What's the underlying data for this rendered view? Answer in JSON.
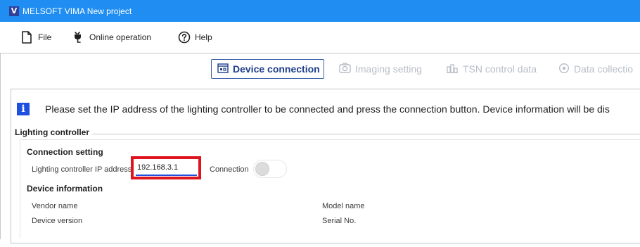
{
  "window": {
    "app_icon_glyph": "V",
    "title": "MELSOFT VIMA New project"
  },
  "menu": {
    "items": [
      {
        "label": "File",
        "icon": "file-icon"
      },
      {
        "label": "Online operation",
        "icon": "plug-icon"
      },
      {
        "label": "Help",
        "icon": "help-icon"
      }
    ]
  },
  "tabs": [
    {
      "label": "Device connection",
      "icon": "device-connection-icon",
      "state": "active"
    },
    {
      "label": "Imaging setting",
      "icon": "camera-icon",
      "state": "disabled"
    },
    {
      "label": "TSN control data",
      "icon": "tsn-control-icon",
      "state": "disabled"
    },
    {
      "label": "Data collectio",
      "icon": "record-icon",
      "state": "disabled"
    }
  ],
  "info": {
    "icon_glyph": "i",
    "message": "Please set the IP address of the lighting controller to be connected and press the connection button. Device information will be dis"
  },
  "lighting_controller": {
    "title": "Lighting controller",
    "connection_setting": {
      "heading": "Connection setting",
      "ip_label": "Lighting controller IP address",
      "ip_value": "192.168.3.1",
      "connection_label": "Connection",
      "connection_on": false
    },
    "device_information": {
      "heading": "Device information",
      "vendor_label": "Vendor name",
      "model_label": "Model name",
      "version_label": "Device version",
      "serial_label": "Serial No."
    }
  },
  "colors": {
    "titlebar": "#1f8df2",
    "accent": "#1e4fe0",
    "highlight": "#e0141e",
    "tab_active": "#1e3f8a",
    "tab_disabled": "#b8bec7"
  }
}
